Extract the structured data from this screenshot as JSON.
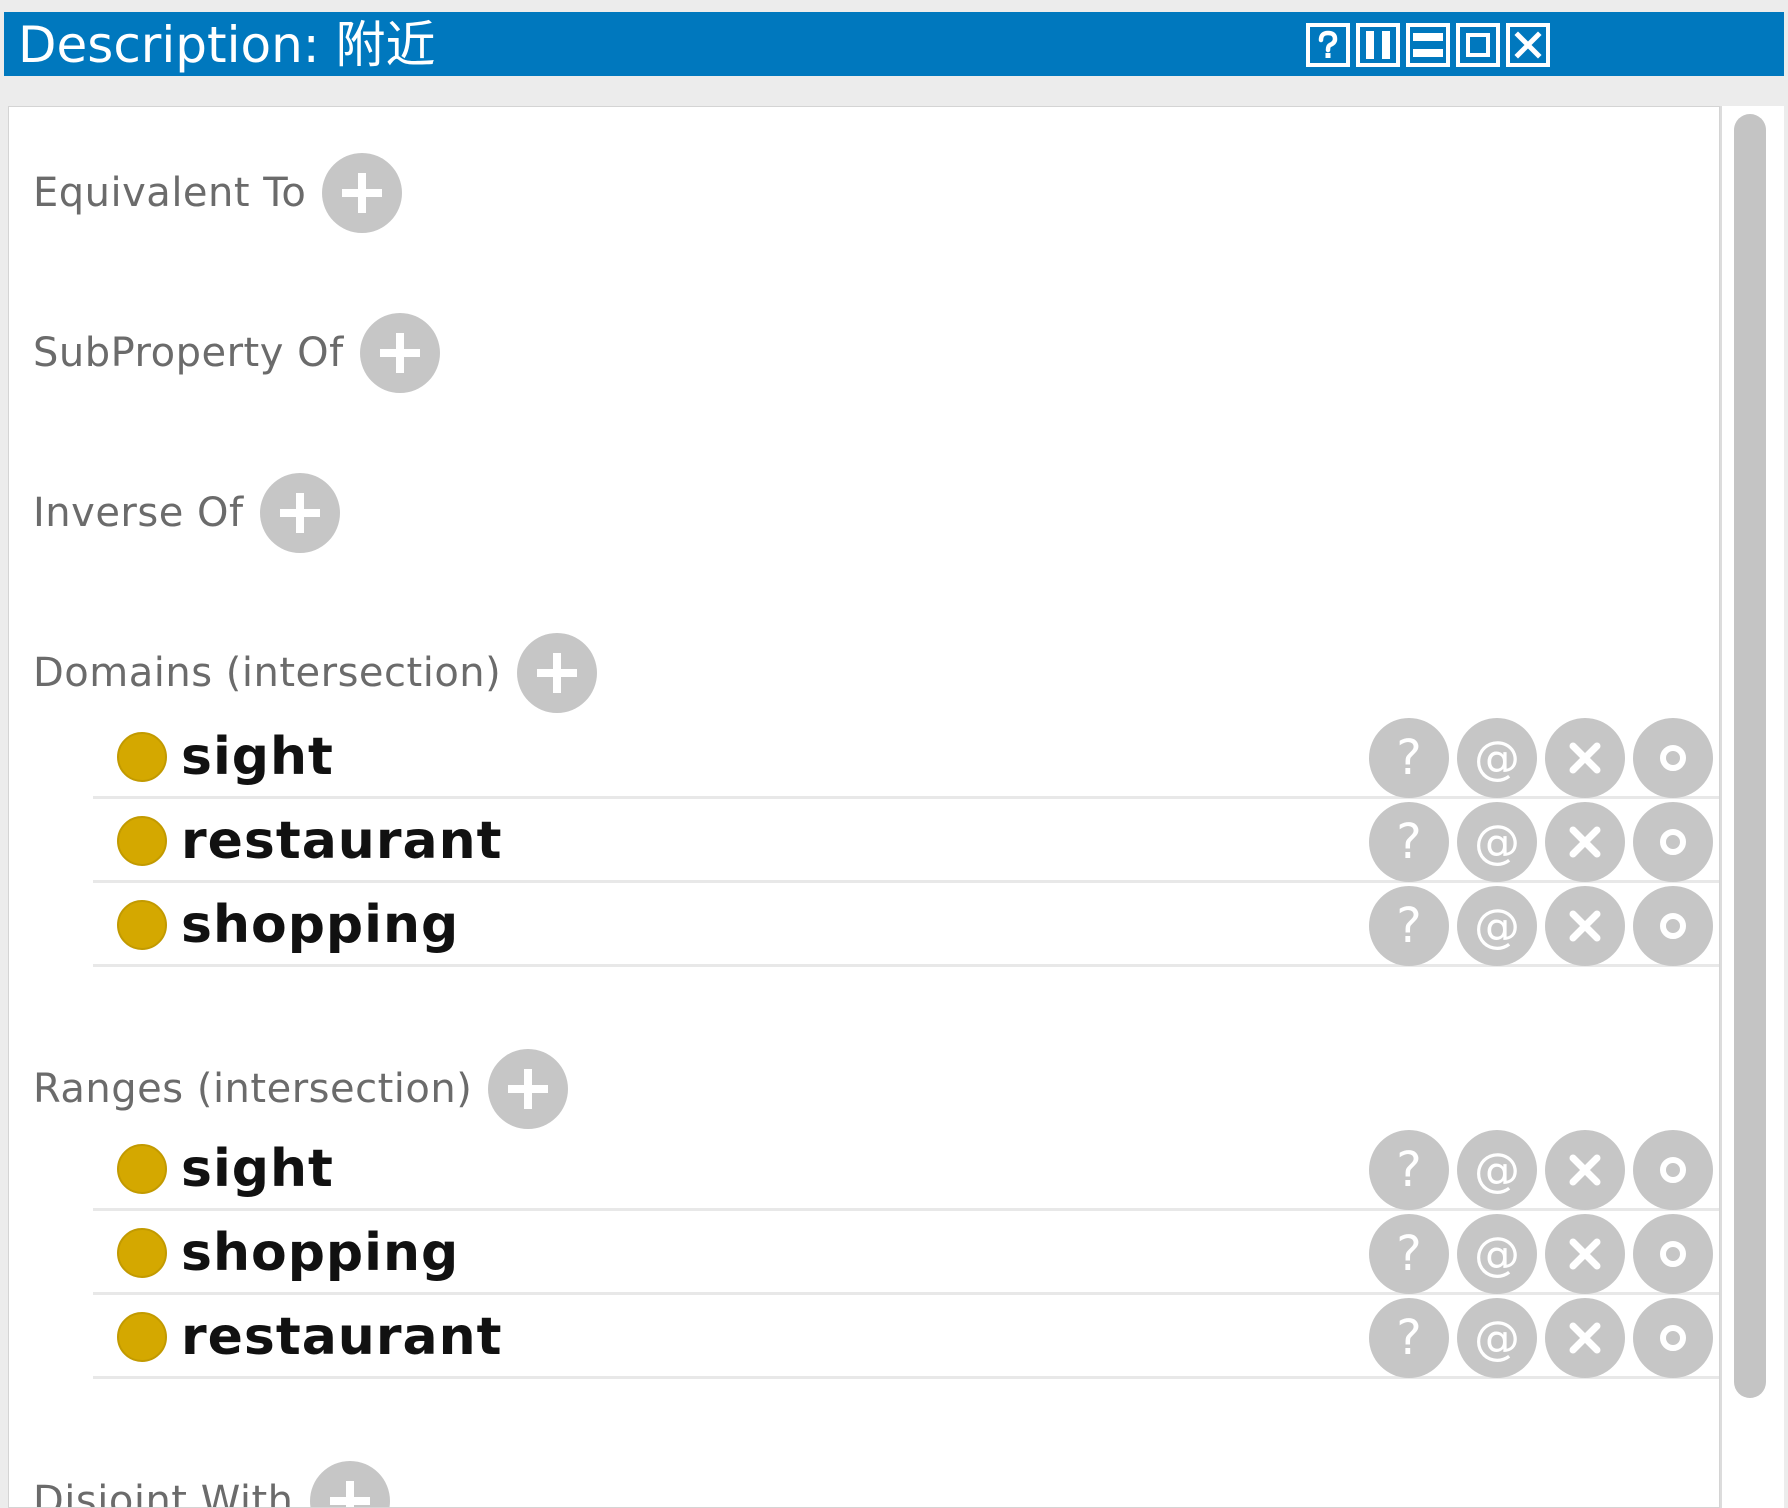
{
  "window": {
    "title": "Description: 附近",
    "buttons": [
      {
        "name": "help-window-button",
        "icon": "question-icon"
      },
      {
        "name": "split-vertical-button",
        "icon": "split-columns-icon"
      },
      {
        "name": "split-horizontal-button",
        "icon": "split-rows-icon"
      },
      {
        "name": "maximize-button",
        "icon": "maximize-icon"
      },
      {
        "name": "close-window-button",
        "icon": "close-icon"
      }
    ]
  },
  "sections": {
    "equivalent_to": {
      "label": "Equivalent To"
    },
    "subproperty_of": {
      "label": "SubProperty Of"
    },
    "inverse_of": {
      "label": "Inverse Of"
    },
    "domains": {
      "label": "Domains (intersection)",
      "items": [
        "sight",
        "restaurant",
        "shopping"
      ]
    },
    "ranges": {
      "label": "Ranges (intersection)",
      "items": [
        "sight",
        "shopping",
        "restaurant"
      ]
    },
    "disjoint_with": {
      "label": "Disjoint With"
    }
  },
  "row_actions": {
    "explain": "?",
    "annotate": "@",
    "delete": "×",
    "edit": "o"
  },
  "colors": {
    "title_bar": "#0078be",
    "class_dot": "#d4a800",
    "button_gray": "#c6c6c6",
    "label_gray": "#6b6b6b"
  }
}
